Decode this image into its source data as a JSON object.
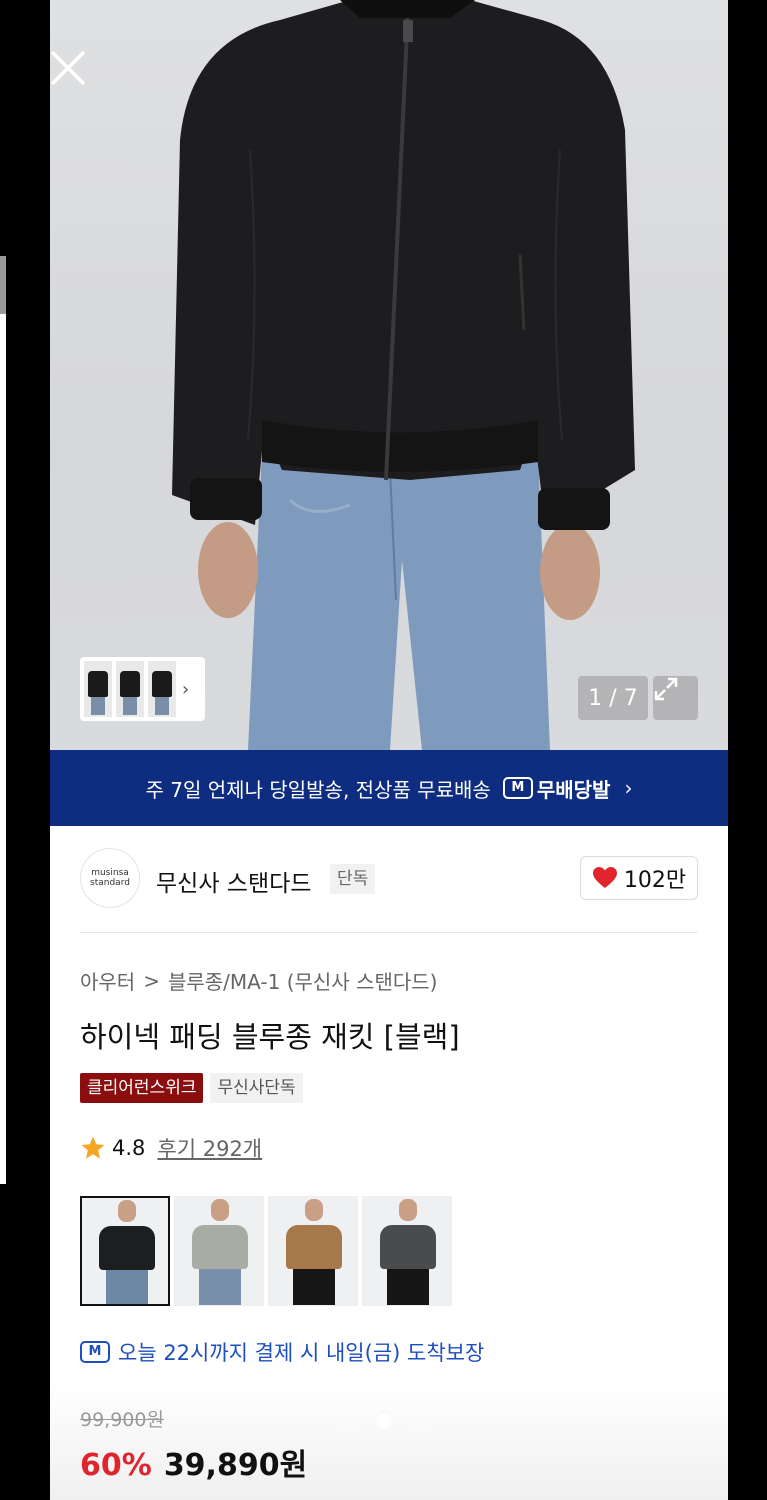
{
  "hero": {
    "pager": "1 / 7"
  },
  "banner": {
    "text": "주 7일 언제나 당일발송, 전상품 무료배송",
    "badge_icon": "M",
    "badge_label": "무배당발",
    "chevron": "›"
  },
  "brand": {
    "logo_line1": "musinsa",
    "logo_line2": "standard",
    "name": "무신사 스탠다드",
    "tag": "단독",
    "like_count": "102만"
  },
  "breadcrumb": {
    "level1": "아우터",
    "sep": ">",
    "level2": "블루종/MA-1 (무신사 스탠다드)"
  },
  "product": {
    "title": "하이넥 패딩 블루종 재킷 [블랙]",
    "tags": [
      "클리어런스위크",
      "무신사단독"
    ],
    "rating": "4.8",
    "reviews": "후기 292개"
  },
  "swatches": [
    {
      "name": "black",
      "jacket": "#1d1e20",
      "pants": "#6e87a6"
    },
    {
      "name": "gray",
      "jacket": "#a9aca5",
      "pants": "#7990ad"
    },
    {
      "name": "camel",
      "jacket": "#a77849",
      "pants": "#161616"
    },
    {
      "name": "charcoal",
      "jacket": "#4a4b4d",
      "pants": "#151515"
    }
  ],
  "delivery": {
    "icon": "M",
    "text": "오늘 22시까지 결제 시 내일(금) 도착보장"
  },
  "price": {
    "original": "99,900원",
    "discount": "60%",
    "sale": "39,890원"
  },
  "colors": {
    "banner": "#0f2d80",
    "discount": "#e0262c",
    "tag_red": "#8a0e0e",
    "delivery": "#1d4fbf"
  }
}
